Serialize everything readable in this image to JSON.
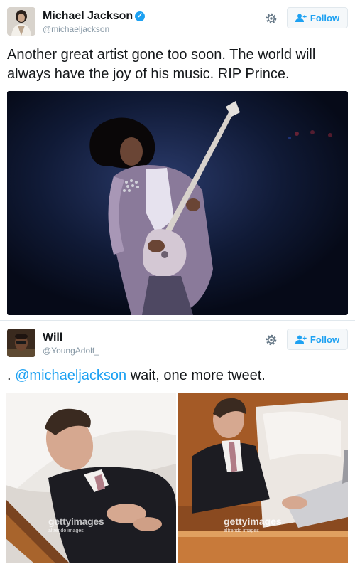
{
  "tweets": [
    {
      "name": "Michael Jackson",
      "verified": true,
      "handle": "@michaeljackson",
      "follow_label": "Follow",
      "text": "Another great artist gone too soon. The world will always have the joy of his music. RIP Prince.",
      "colors": {
        "link": "#1da1f2",
        "photo_bg": "#0b1327"
      }
    },
    {
      "name": "Will",
      "handle": "@YoungAdolf_",
      "follow_label": "Follow",
      "text_prefix": ".",
      "mention": "@michaeljackson",
      "text_suffix": "wait, one more tweet.",
      "images": [
        {
          "watermark": "gettyimages",
          "watermark_sub": "altrendo images"
        },
        {
          "watermark": "gettyimages",
          "watermark_sub": "altrendo images"
        }
      ]
    }
  ],
  "icons": {
    "settings": "gear-icon",
    "follow": "person-add-icon",
    "verified": "verified-badge-icon"
  }
}
